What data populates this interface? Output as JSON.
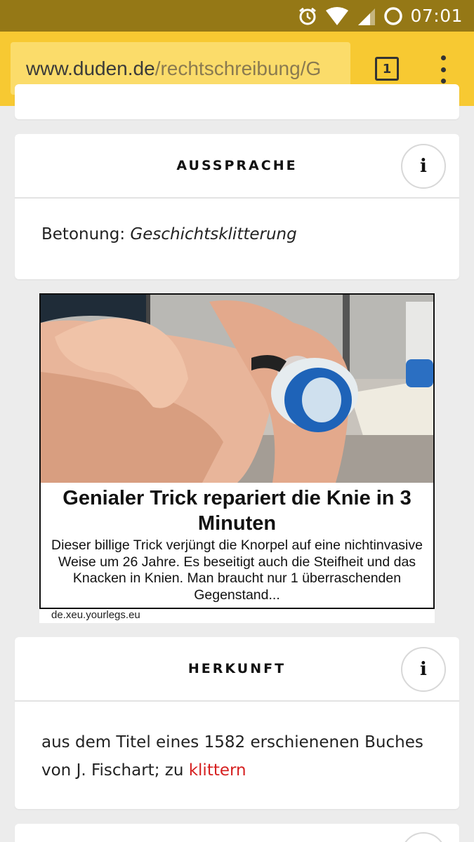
{
  "status_bar": {
    "time": "07:01",
    "icons": [
      "alarm-icon",
      "wifi-icon",
      "signal-icon",
      "battery-icon"
    ],
    "background": "#957816"
  },
  "browser": {
    "url_host": "www.duden.de",
    "url_path": "/rechtschreibung/G",
    "tab_count": "1",
    "toolbar_color": "#f7c932"
  },
  "aussprache": {
    "title": "AUSSPRACHE",
    "info_label": "i",
    "betonung_label": "Betonung: ",
    "betonung_value": "Geschichtsklitterung"
  },
  "ad": {
    "headline": "Genialer Trick repariert die Knie in 3 Minuten",
    "text": "Dieser billige Trick verjüngt die Knorpel auf eine nichtinvasive Weise um 26 Jahre. Es beseitigt auch die Steifheit und das Knacken in Knien. Man braucht nur 1 überraschenden Gegenstand...",
    "source": "de.xeu.yourlegs.eu"
  },
  "herkunft": {
    "title": "HERKUNFT",
    "info_label": "i",
    "text": "aus dem Titel eines 1582 erschienenen Buches von J.  Fischart; zu ",
    "link": "klittern",
    "link_color": "#d62020"
  },
  "next_card": {
    "info_label": "i"
  }
}
